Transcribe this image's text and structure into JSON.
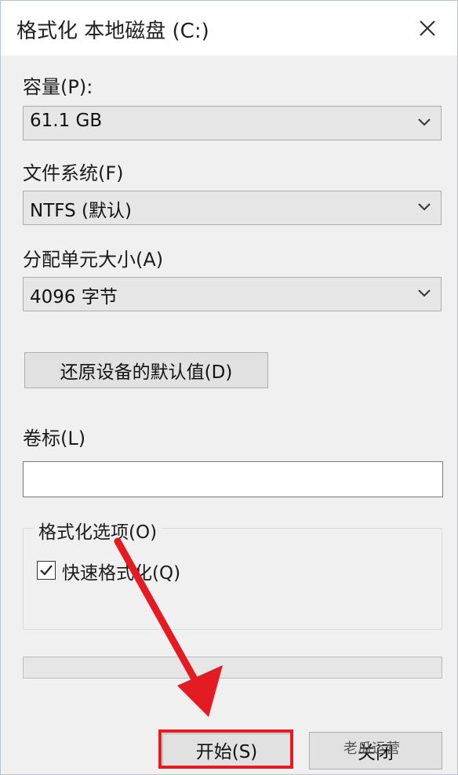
{
  "window": {
    "title": "格式化 本地磁盘 (C:)"
  },
  "capacity": {
    "label": "容量(P):",
    "value": "61.1 GB"
  },
  "filesystem": {
    "label": "文件系统(F)",
    "value": "NTFS (默认)"
  },
  "allocation": {
    "label": "分配单元大小(A)",
    "value": "4096 字节"
  },
  "restore_button": "还原设备的默认值(D)",
  "volume": {
    "label": "卷标(L)",
    "value": ""
  },
  "options": {
    "legend": "格式化选项(O)",
    "quick_format": {
      "label": "快速格式化(Q)",
      "checked": true
    }
  },
  "progress": {
    "fraction": 0
  },
  "buttons": {
    "start": "开始(S)",
    "close": "关闭"
  },
  "watermark": "老瓜运营",
  "colors": {
    "highlight": "#e41b23",
    "arrow": "#e41b23"
  },
  "icons": {
    "close": "close-icon",
    "chevron": "chevron-down-icon",
    "check": "checkmark-icon"
  }
}
